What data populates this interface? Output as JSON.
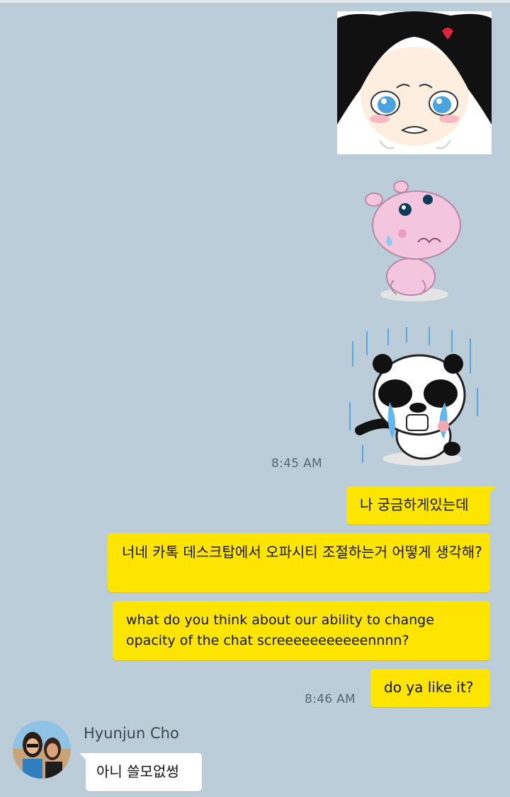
{
  "messages": {
    "time_1": "8:45 AM",
    "outgoing": [
      {
        "text": "나 궁금하게있는데"
      },
      {
        "text": "너네 카톡 데스크탑에서 오파시티 조절하는거 어떻게 생각해?"
      },
      {
        "text": "what do you think about our ability to change opacity of the chat screeeeeeeeeeennnn?"
      },
      {
        "text": "do ya like it?"
      }
    ],
    "time_2": "8:46 AM",
    "incoming": {
      "sender": "Hyunjun Cho",
      "text": "아니 쓸모없썽"
    }
  },
  "colors": {
    "background": "#bacdd9",
    "outgoing_bubble": "#fee500",
    "incoming_bubble": "#ffffff"
  },
  "stickers": [
    "crying-girl-sticker",
    "crying-hippo-sticker",
    "crying-panda-sticker"
  ]
}
